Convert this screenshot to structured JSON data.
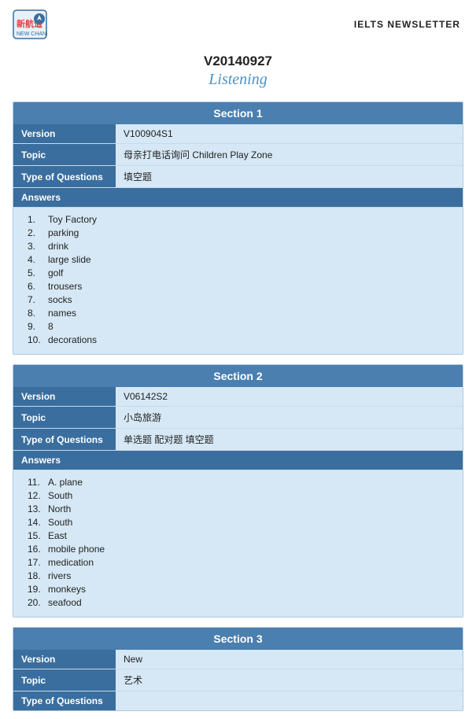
{
  "header": {
    "brand_name": "新航道",
    "brand_sub": "NEW CHANNEL",
    "newsletter_label": "IELTS NEWSLETTER"
  },
  "main_title": {
    "code": "V20140927",
    "subtitle": "Listening"
  },
  "sections": [
    {
      "id": "section1",
      "title": "Section 1",
      "version": "V100904S1",
      "topic": "母亲打电话询问 Children Play Zone",
      "type_of_questions": "填空题",
      "answers_label": "Answers",
      "answers": [
        {
          "num": "1.",
          "text": "Toy Factory"
        },
        {
          "num": "2.",
          "text": "parking"
        },
        {
          "num": "3.",
          "text": "drink"
        },
        {
          "num": "4.",
          "text": "large slide"
        },
        {
          "num": "5.",
          "text": "golf"
        },
        {
          "num": "6.",
          "text": "trousers"
        },
        {
          "num": "7.",
          "text": "socks"
        },
        {
          "num": "8.",
          "text": "names"
        },
        {
          "num": "9.",
          "text": "8"
        },
        {
          "num": "10.",
          "text": "decorations"
        }
      ]
    },
    {
      "id": "section2",
      "title": "Section 2",
      "version": "V06142S2",
      "topic": "小岛旅游",
      "type_of_questions": "单选题 配对题 填空题",
      "answers_label": "Answers",
      "answers": [
        {
          "num": "11.",
          "text": "A. plane"
        },
        {
          "num": "12.",
          "text": "South"
        },
        {
          "num": "13.",
          "text": "North"
        },
        {
          "num": "14.",
          "text": "South"
        },
        {
          "num": "15.",
          "text": "East"
        },
        {
          "num": "16.",
          "text": "mobile phone"
        },
        {
          "num": "17.",
          "text": "medication"
        },
        {
          "num": "18.",
          "text": "rivers"
        },
        {
          "num": "19.",
          "text": "monkeys"
        },
        {
          "num": "20.",
          "text": "seafood"
        }
      ]
    },
    {
      "id": "section3",
      "title": "Section 3",
      "version": "New",
      "topic": "艺术",
      "type_of_questions": "",
      "answers_label": "",
      "answers": []
    }
  ],
  "labels": {
    "version": "Version",
    "topic": "Topic",
    "type_of_questions": "Type of Questions",
    "answers": "Answers"
  }
}
